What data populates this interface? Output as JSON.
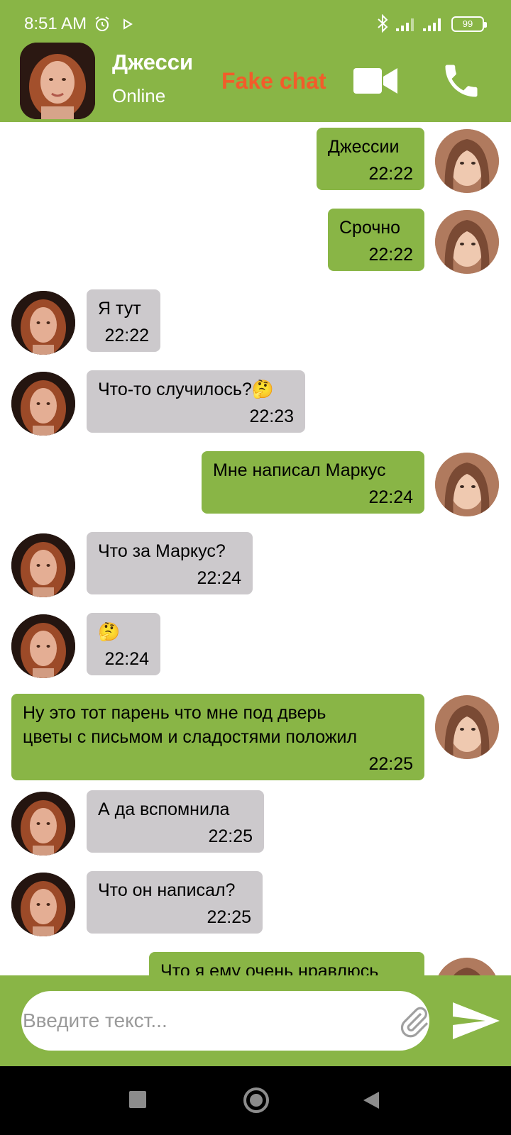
{
  "status_bar": {
    "time": "8:51 AM",
    "battery": "99",
    "icons": [
      "alarm-icon",
      "play-store-icon",
      "bluetooth-icon",
      "signal-icon",
      "signal-icon",
      "battery-icon"
    ]
  },
  "header": {
    "contact_name": "Джесси",
    "contact_status": "Online",
    "app_label": "Fake chat",
    "icons": [
      "video-call-icon",
      "phone-call-icon"
    ]
  },
  "messages": [
    {
      "from": "me",
      "text": "Джессии",
      "time": "22:22"
    },
    {
      "from": "me",
      "text": "Срочно",
      "time": "22:22"
    },
    {
      "from": "her",
      "text": "Я тут",
      "time": "22:22"
    },
    {
      "from": "her",
      "text": "Что-то случилось?🤔",
      "time": "22:23"
    },
    {
      "from": "me",
      "text": "Мне написал Маркус",
      "time": "22:24"
    },
    {
      "from": "her",
      "text": "Что за Маркус?",
      "time": "22:24"
    },
    {
      "from": "her",
      "text": "🤔",
      "time": "22:24"
    },
    {
      "from": "me",
      "text": "Ну это тот парень что мне под дверь\nцветы с письмом и сладостями положил",
      "time": "22:25"
    },
    {
      "from": "her",
      "text": "А да вспомнила",
      "time": "22:25"
    },
    {
      "from": "her",
      "text": "Что он написал?",
      "time": "22:25"
    },
    {
      "from": "me",
      "text": "Что я ему очень нравлюсь",
      "time": ""
    }
  ],
  "composer": {
    "placeholder": "Введите текст...",
    "icons": [
      "attach-icon",
      "send-icon"
    ]
  },
  "colors": {
    "accent": "#89b546",
    "incoming_bubble": "#ccc9cc",
    "app_label": "#f25c2a"
  }
}
